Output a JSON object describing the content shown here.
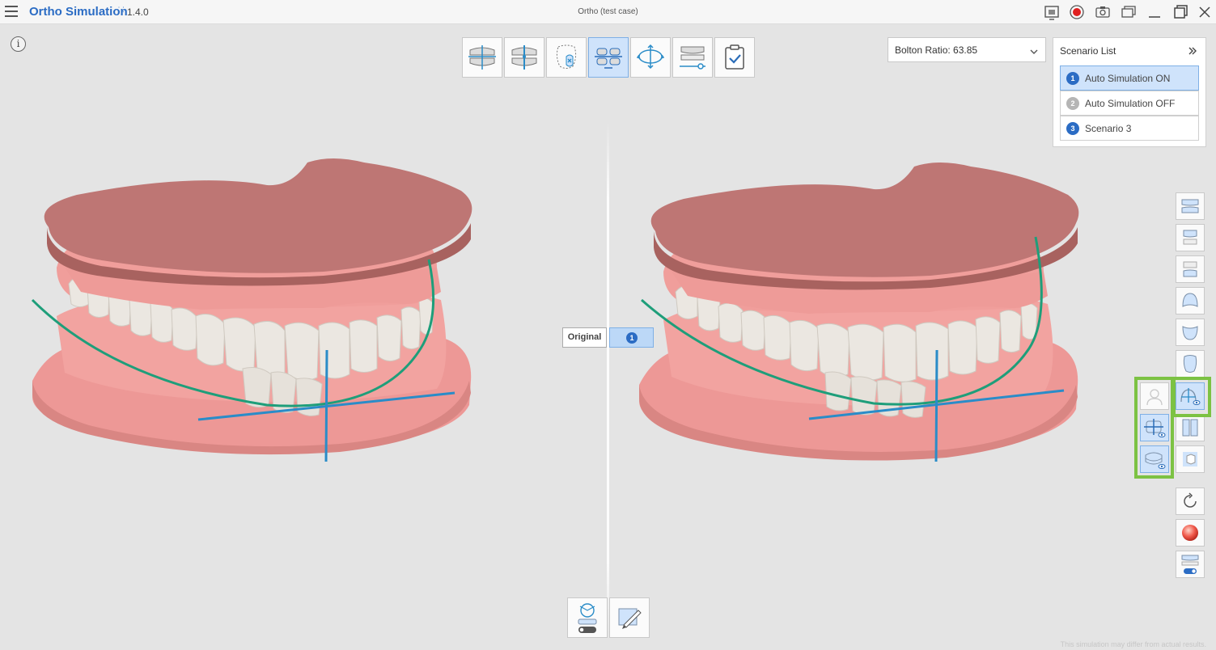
{
  "app": {
    "title": "Ortho Simulation",
    "version_mark": "⸬",
    "version": "1.4.0",
    "case_title": "Ortho (test case)"
  },
  "window_controls": [
    "screen-capture-icon",
    "record-icon",
    "camera-icon",
    "window-switch-icon",
    "minimize-icon",
    "maximize-icon",
    "close-icon"
  ],
  "top_toolbar": {
    "tools": [
      {
        "name": "occlusion-tool",
        "icon": "jaw-occlusion-icon",
        "active": false
      },
      {
        "name": "midline-tool",
        "icon": "jaw-midline-icon",
        "active": false
      },
      {
        "name": "tooth-exclusion-tool",
        "icon": "tooth-exclude-icon",
        "active": false
      },
      {
        "name": "arch-alignment-tool",
        "icon": "arch-align-icon",
        "active": true
      },
      {
        "name": "rotate-view-tool",
        "icon": "rotate-view-icon",
        "active": false
      },
      {
        "name": "jaw-adjust-tool",
        "icon": "jaw-slider-icon",
        "active": false
      },
      {
        "name": "finish-tool",
        "icon": "clipboard-check-icon",
        "active": false
      }
    ]
  },
  "bolton": {
    "label": "Bolton Ratio: 63.85"
  },
  "scenario_list": {
    "title": "Scenario List",
    "items": [
      {
        "number": "1",
        "label": "Auto Simulation ON",
        "selected": true,
        "color": "#2b6cc4"
      },
      {
        "number": "2",
        "label": "Auto Simulation OFF",
        "selected": false,
        "color": "#b5b5b5"
      },
      {
        "number": "3",
        "label": "Scenario 3",
        "selected": false,
        "color": "#2b6cc4"
      }
    ]
  },
  "compare": {
    "original_label": "Original",
    "scenario_number": "1"
  },
  "colors": {
    "gum": "#ef9a98",
    "gum_dark": "#d98683",
    "base_top": "#be7674",
    "tooth": "#e9e5df",
    "arch_curve": "#1e9e7a",
    "axis_line": "#2a8cc8",
    "accent": "#2b6cc4",
    "highlight": "#7cc243"
  },
  "disclaimer": "This simulation may differ from actual results."
}
